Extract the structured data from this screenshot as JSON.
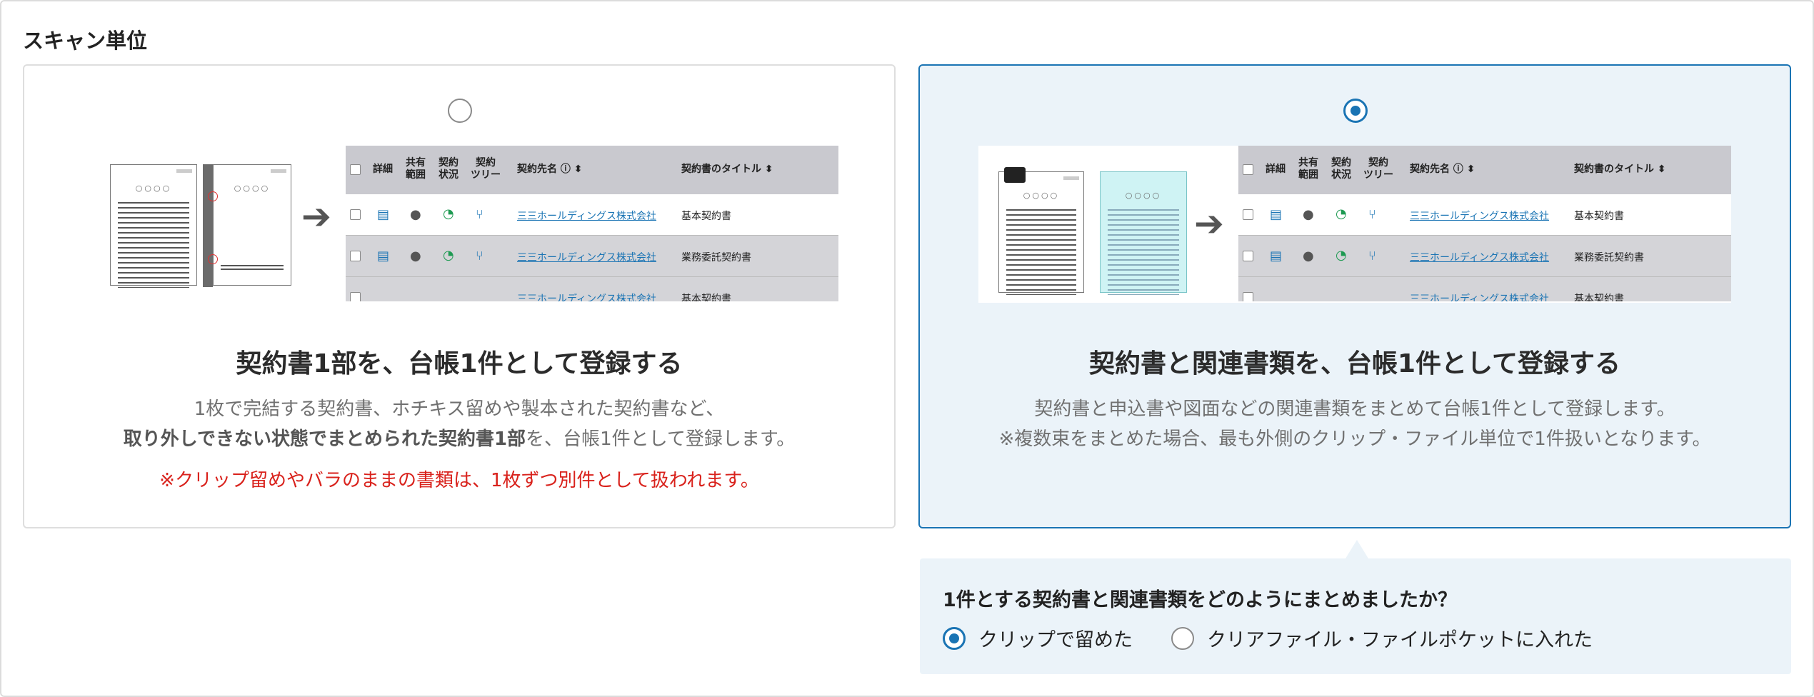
{
  "section_title": "スキャン単位",
  "cards": [
    {
      "selected": false,
      "title": "契約書1部を、台帳1件として登録する",
      "desc_line1": "1枚で完結する契約書、ホチキス留めや製本された契約書など、",
      "desc_line2_bold": "取り外しできない状態でまとめられた契約書1部",
      "desc_line2_rest": "を、台帳1件として登録します。",
      "warning": "※クリップ留めやバラのままの書類は、1枚ずつ別件として扱われます。"
    },
    {
      "selected": true,
      "title": "契約書と関連書類を、台帳1件として登録する",
      "desc_line1": "契約書と申込書や図面などの関連書類をまとめて台帳1件として登録します。",
      "desc_line2": "※複数束をまとめた場合、最も外側のクリップ・ファイル単位で1件扱いとなります。"
    }
  ],
  "illustration": {
    "doc_dots": "○○○○",
    "table_headers": {
      "detail": "詳細",
      "share": "共有\n範囲",
      "status": "契約\n状況",
      "tree": "契約\nツリー",
      "party": "契約先名 ⓘ ⬍",
      "doc_title": "契約書のタイトル ⬍"
    },
    "rows": [
      {
        "party": "三三ホールディングス株式会社",
        "title": "基本契約書"
      },
      {
        "party": "三三ホールディングス株式会社",
        "title": "業務委託契約書"
      },
      {
        "party": "三三ホールディングス株式会社",
        "title": "基本契約書"
      }
    ]
  },
  "subpanel": {
    "question": "1件とする契約書と関連書類をどのようにまとめましたか？",
    "options": [
      {
        "label": "クリップで留めた",
        "selected": true
      },
      {
        "label": "クリアファイル・ファイルポケットに入れた",
        "selected": false
      }
    ]
  },
  "colors": {
    "accent": "#1a74b4",
    "warning": "#d9221c",
    "selected_bg": "#ebf3f9"
  }
}
